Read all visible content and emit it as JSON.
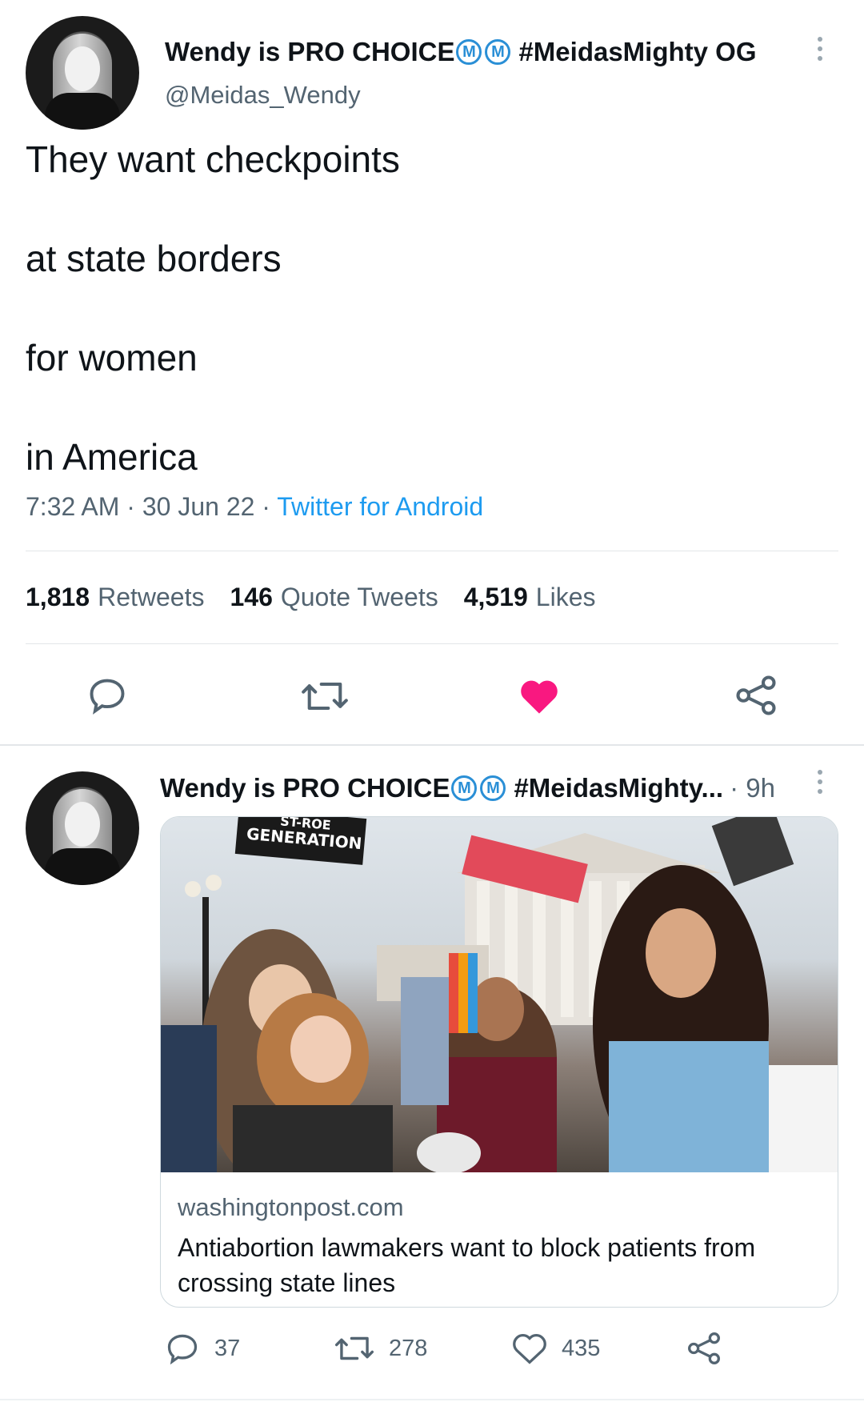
{
  "main_tweet": {
    "author": {
      "name": "Wendy is PRO CHOICE",
      "badge1": "M",
      "badge2": "M",
      "name_suffix": "#MeidasMighty OG",
      "handle": "@Meidas_Wendy"
    },
    "text_lines": [
      "They want checkpoints",
      "at state borders",
      "for women",
      "in America"
    ],
    "time": "7:32 AM",
    "date": "30 Jun 22",
    "source": "Twitter for Android",
    "stats": {
      "retweets_count": "1,818",
      "retweets_label": "Retweets",
      "quotes_count": "146",
      "quotes_label": "Quote Tweets",
      "likes_count": "4,519",
      "likes_label": "Likes"
    },
    "liked": true,
    "like_color": "#f91880"
  },
  "second_tweet": {
    "author": {
      "name": "Wendy is PRO CHOICE",
      "badge1": "M",
      "badge2": "M",
      "name_suffix": "#MeidasMighty...",
      "time": "· 9h"
    },
    "card": {
      "image_sign_text": "GENERATION",
      "image_sign_top": "ST-ROE",
      "domain": "washingtonpost.com",
      "title": "Antiabortion lawmakers want to block patients from crossing state lines"
    },
    "counts": {
      "replies": "37",
      "retweets": "278",
      "likes": "435"
    }
  },
  "colors": {
    "accent": "#1d9bf0",
    "text": "#0f1419",
    "secondary": "#536471",
    "badge": "#2a8fd6"
  },
  "icons": [
    "more-icon",
    "reply-icon",
    "retweet-icon",
    "like-icon",
    "share-icon"
  ]
}
